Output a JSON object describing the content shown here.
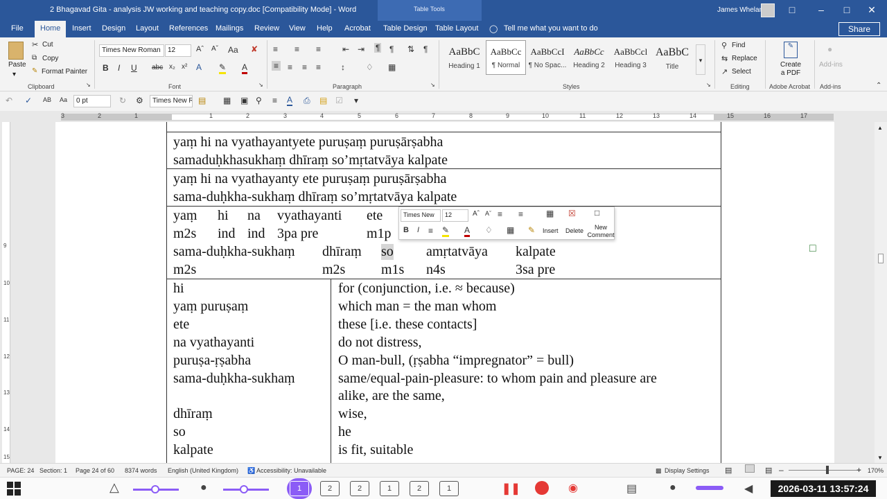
{
  "window": {
    "title": "2 Bhagavad Gita - analysis JW working and teaching copy.doc [Compatibility Mode] - Word",
    "context_tab": "Table Tools",
    "user": "James Whelan",
    "minimize": "–",
    "restore": "□",
    "close": "✕"
  },
  "tabs": [
    "File",
    "Home",
    "Insert",
    "Design",
    "Layout",
    "References",
    "Mailings",
    "Review",
    "View",
    "Help",
    "Acrobat",
    "Table Design",
    "Table Layout"
  ],
  "tell_me": "Tell me what you want to do",
  "share_label": "Share",
  "ribbon": {
    "clipboard": {
      "paste": "Paste",
      "cut": "Cut",
      "copy": "Copy",
      "format_painter": "Format Painter",
      "group": "Clipboard"
    },
    "font": {
      "name": "Times New Roman",
      "size": "12",
      "group": "Font"
    },
    "paragraph": {
      "group": "Paragraph"
    },
    "styles": {
      "group": "Styles",
      "items": [
        {
          "preview": "AaBbC",
          "name": "Heading 1"
        },
        {
          "preview": "AaBbCc",
          "name": "¶ Normal"
        },
        {
          "preview": "AaBbCcI",
          "name": "¶ No Spac..."
        },
        {
          "preview": "AaBbCc",
          "name": "Heading 2"
        },
        {
          "preview": "AaBbCcl",
          "name": "Heading 3"
        },
        {
          "preview": "AaBbC",
          "name": "Title"
        }
      ]
    },
    "editing": {
      "find": "Find",
      "replace": "Replace",
      "select": "Select",
      "group": "Editing"
    },
    "acrobat": {
      "create_pdf": "Create a PDF",
      "group": "Adobe Acrobat"
    },
    "addins": {
      "label": "Add-ins",
      "group": "Add-ins"
    }
  },
  "qat": {
    "spacing": "0 pt",
    "font": "Times New R"
  },
  "ruler_marks": [
    "3",
    "2",
    "1",
    "1",
    "2",
    "3",
    "4",
    "5",
    "6",
    "7",
    "8",
    "9",
    "10",
    "11",
    "12",
    "13",
    "14",
    "15",
    "16",
    "17"
  ],
  "vruler_marks": [
    "9",
    "10",
    "11",
    "12",
    "13",
    "14",
    "15"
  ],
  "document": {
    "row1": [
      "yaṃ hi na vyathayantyete puruṣaṃ puruṣārṣabha",
      "samaduḥkhasukhaṃ dhīraṃ so’mṛtatvāya kalpate"
    ],
    "row2": [
      "yaṃ hi na vyathayanty ete puruṣaṃ puruṣārṣabha",
      "sama-duḥkha-sukhaṃ dhīraṃ so’mṛtatvāya kalpate"
    ],
    "row3_words": [
      "yaṃ",
      "hi",
      "na",
      "vyathayanti",
      "ete"
    ],
    "row3_tags": [
      "m2s",
      "ind",
      "ind",
      "3pa pre",
      "m1p"
    ],
    "row3_words2": [
      "sama-duḥkha-sukhaṃ",
      "dhīraṃ",
      "so",
      "amṛtatvāya",
      "kalpate"
    ],
    "row3_tags2": [
      "m2s",
      "m2s",
      "m1s",
      "n4s",
      "3sa pre"
    ],
    "glossary": [
      {
        "term": "hi",
        "def": "for (conjunction, i.e. ≈ because)"
      },
      {
        "term": "yaṃ puruṣaṃ",
        "def": "which man = the man whom"
      },
      {
        "term": "ete",
        "def": "these [i.e. these contacts]"
      },
      {
        "term": "na vyathayanti",
        "def": "do not distress,"
      },
      {
        "term": "puruṣa-ṛṣabha",
        "def": "O man-bull, (ṛṣabha “impregnator” = bull)"
      },
      {
        "term": "sama-duḥkha-sukhaṃ",
        "def": "same/equal-pain-pleasure: to whom pain and pleasure are"
      },
      {
        "term": "",
        "def": "alike, are the same,"
      },
      {
        "term": "dhīraṃ",
        "def": "wise,"
      },
      {
        "term": "so",
        "def": "he"
      },
      {
        "term": "kalpate",
        "def": "is fit, suitable"
      }
    ]
  },
  "mini_toolbar": {
    "font": "Times New",
    "size": "12",
    "insert": "Insert",
    "delete": "Delete",
    "new_comment": "New Comment"
  },
  "status": {
    "page": "PAGE: 24",
    "section": "Section: 1",
    "page_of": "Page 24 of 60",
    "words": "8374 words",
    "language": "English (United Kingdom)",
    "accessibility": "Accessibility: Unavailable",
    "display": "Display Settings",
    "zoom": "170%"
  },
  "taskbar": {
    "pages": [
      "1",
      "2",
      "2",
      "1",
      "2",
      "1"
    ],
    "clock": "2026-03-11 13:57:24"
  }
}
